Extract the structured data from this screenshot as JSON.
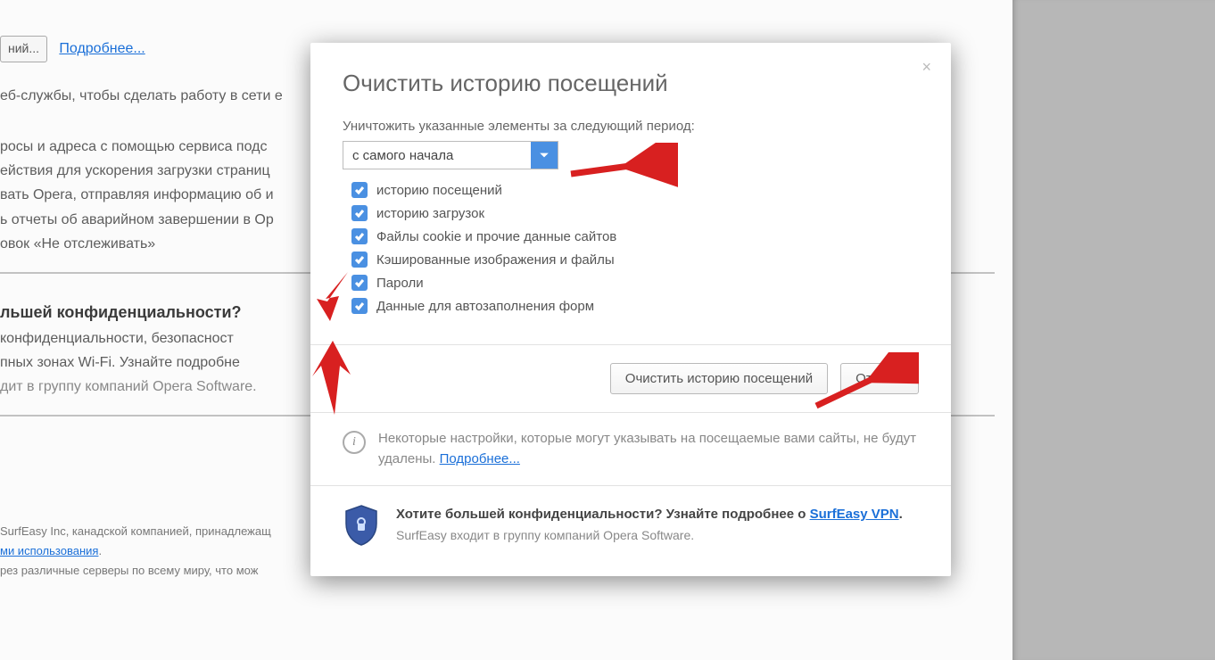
{
  "background": {
    "button1": "ний...",
    "link_more": "Подробнее...",
    "line_webservices": "еб-службы, чтобы сделать работу в сети е",
    "line_queries": "росы и адреса с помощью сервиса подс",
    "line_actions": "ействия для ускорения загрузки страниц",
    "line_opera_info": "вать Opera, отправляя информацию об и",
    "line_crash": "ь отчеты об аварийном завершении в Op",
    "line_dnt": "овок «Не отслеживать»",
    "heading_priv": "льшей конфиденциальности?",
    "line_priv1": "конфиденциальности, безопасност",
    "line_priv2": "пных зонах Wi-Fi. Узнайте подробне",
    "line_priv3": "дит в группу компаний Opera Software.",
    "foot_line1a": "SurfEasy Inc, канадской компанией, принадлежащ",
    "foot_link": "ми использования",
    "foot_line2": "рез различные серверы по всему миру, что мож"
  },
  "modal": {
    "title": "Очистить историю посещений",
    "close_icon": "×",
    "period_label": "Уничтожить указанные элементы за следующий период:",
    "period_value": "с самого начала",
    "checks": [
      "историю посещений",
      "историю загрузок",
      "Файлы cookie и прочие данные сайтов",
      "Кэшированные изображения и файлы",
      "Пароли",
      "Данные для автозаполнения форм"
    ],
    "btn_clear": "Очистить историю посещений",
    "btn_cancel": "Отмена",
    "info_text1": "Некоторые настройки, которые могут указывать на посещаемые вами сайты, ",
    "info_text2": "не будут удалены.",
    "info_more": "Подробнее...",
    "vpn_bold1": "Хотите большей конфиденциальности? Узнайте подробнее о ",
    "vpn_link": "SurfEasy VPN",
    "vpn_sub": "SurfEasy входит в группу компаний Opera Software."
  }
}
